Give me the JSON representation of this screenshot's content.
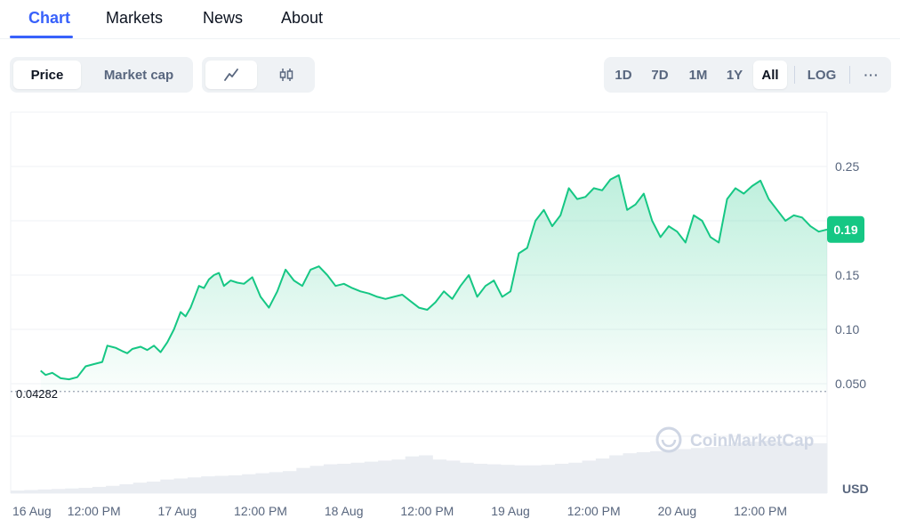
{
  "nav": {
    "tabs": [
      {
        "label": "Chart",
        "active": true
      },
      {
        "label": "Markets",
        "active": false
      },
      {
        "label": "News",
        "active": false
      },
      {
        "label": "About",
        "active": false
      }
    ]
  },
  "toolbar": {
    "metric_tabs": [
      {
        "label": "Price",
        "active": true
      },
      {
        "label": "Market cap",
        "active": false
      }
    ],
    "view_icons": [
      {
        "name": "line-chart-icon",
        "active": true
      },
      {
        "name": "candlestick-icon",
        "active": false
      }
    ],
    "ranges": [
      {
        "label": "1D",
        "active": false
      },
      {
        "label": "7D",
        "active": false
      },
      {
        "label": "1M",
        "active": false
      },
      {
        "label": "1Y",
        "active": false
      },
      {
        "label": "All",
        "active": true
      }
    ],
    "log_label": "LOG",
    "more_label": "···"
  },
  "colors": {
    "accent": "#3861fb",
    "line": "#16c784",
    "badge_bg": "#16c784",
    "axis_text": "#58667e",
    "grid": "#eff2f5"
  },
  "chart_data": {
    "type": "area",
    "currency_label": "USD",
    "watermark": "CoinMarketCap",
    "current_price_label": "0.19",
    "baseline_label": "0.04282",
    "baseline_value": 0.04282,
    "ylim": [
      0,
      0.3
    ],
    "y_ticks": [
      {
        "value": 0.25,
        "label": "0.25"
      },
      {
        "value": 0.2,
        "label": ""
      },
      {
        "value": 0.15,
        "label": "0.15"
      },
      {
        "value": 0.1,
        "label": "0.10"
      },
      {
        "value": 0.05,
        "label": "0.050"
      }
    ],
    "x_ticks": [
      "16 Aug",
      "12:00 PM",
      "17 Aug",
      "12:00 PM",
      "18 Aug",
      "12:00 PM",
      "19 Aug",
      "12:00 PM",
      "20 Aug",
      "12:00 PM"
    ],
    "x_tick_t": [
      0,
      0.5,
      1,
      1.5,
      2,
      2.5,
      3,
      3.5,
      4,
      4.5
    ],
    "t_max": 4.9,
    "price_series": {
      "t": [
        0.18,
        0.21,
        0.25,
        0.3,
        0.35,
        0.4,
        0.45,
        0.5,
        0.55,
        0.58,
        0.63,
        0.67,
        0.7,
        0.73,
        0.78,
        0.82,
        0.86,
        0.9,
        0.94,
        0.98,
        1.02,
        1.05,
        1.08,
        1.1,
        1.13,
        1.16,
        1.19,
        1.22,
        1.25,
        1.28,
        1.32,
        1.36,
        1.4,
        1.45,
        1.5,
        1.55,
        1.6,
        1.65,
        1.7,
        1.75,
        1.8,
        1.85,
        1.9,
        1.95,
        2.0,
        2.05,
        2.1,
        2.15,
        2.2,
        2.25,
        2.3,
        2.35,
        2.4,
        2.45,
        2.5,
        2.55,
        2.6,
        2.65,
        2.7,
        2.75,
        2.8,
        2.85,
        2.9,
        2.95,
        3.0,
        3.05,
        3.1,
        3.15,
        3.2,
        3.25,
        3.3,
        3.35,
        3.4,
        3.45,
        3.5,
        3.55,
        3.6,
        3.65,
        3.7,
        3.75,
        3.8,
        3.85,
        3.9,
        3.95,
        4.0,
        4.05,
        4.1,
        4.15,
        4.2,
        4.25,
        4.3,
        4.35,
        4.4,
        4.45,
        4.5,
        4.55,
        4.6,
        4.65,
        4.7,
        4.75,
        4.8,
        4.85,
        4.9
      ],
      "values": [
        0.062,
        0.058,
        0.06,
        0.055,
        0.054,
        0.056,
        0.066,
        0.068,
        0.07,
        0.085,
        0.083,
        0.08,
        0.078,
        0.082,
        0.084,
        0.081,
        0.085,
        0.079,
        0.088,
        0.1,
        0.116,
        0.112,
        0.12,
        0.128,
        0.14,
        0.138,
        0.146,
        0.15,
        0.152,
        0.14,
        0.145,
        0.143,
        0.142,
        0.148,
        0.13,
        0.12,
        0.135,
        0.155,
        0.145,
        0.14,
        0.155,
        0.158,
        0.15,
        0.14,
        0.142,
        0.138,
        0.135,
        0.133,
        0.13,
        0.128,
        0.13,
        0.132,
        0.126,
        0.12,
        0.118,
        0.125,
        0.135,
        0.128,
        0.14,
        0.15,
        0.13,
        0.14,
        0.145,
        0.13,
        0.135,
        0.17,
        0.175,
        0.2,
        0.21,
        0.195,
        0.205,
        0.23,
        0.22,
        0.222,
        0.23,
        0.228,
        0.238,
        0.242,
        0.21,
        0.215,
        0.225,
        0.2,
        0.185,
        0.195,
        0.19,
        0.18,
        0.205,
        0.2,
        0.185,
        0.18,
        0.22,
        0.23,
        0.225,
        0.232,
        0.237,
        0.22,
        0.21,
        0.2,
        0.205,
        0.203,
        0.195,
        0.19,
        0.192
      ]
    },
    "volume_series": [
      0.05,
      0.06,
      0.07,
      0.08,
      0.09,
      0.1,
      0.12,
      0.14,
      0.17,
      0.2,
      0.22,
      0.26,
      0.28,
      0.3,
      0.32,
      0.33,
      0.34,
      0.36,
      0.38,
      0.4,
      0.42,
      0.48,
      0.52,
      0.55,
      0.56,
      0.58,
      0.6,
      0.62,
      0.64,
      0.7,
      0.72,
      0.64,
      0.62,
      0.58,
      0.56,
      0.55,
      0.54,
      0.53,
      0.53,
      0.54,
      0.56,
      0.58,
      0.62,
      0.66,
      0.72,
      0.76,
      0.78,
      0.8,
      0.82,
      0.84,
      0.86,
      0.88,
      0.92,
      0.96,
      0.98,
      1.0,
      0.98,
      0.96,
      0.95,
      0.95
    ]
  }
}
